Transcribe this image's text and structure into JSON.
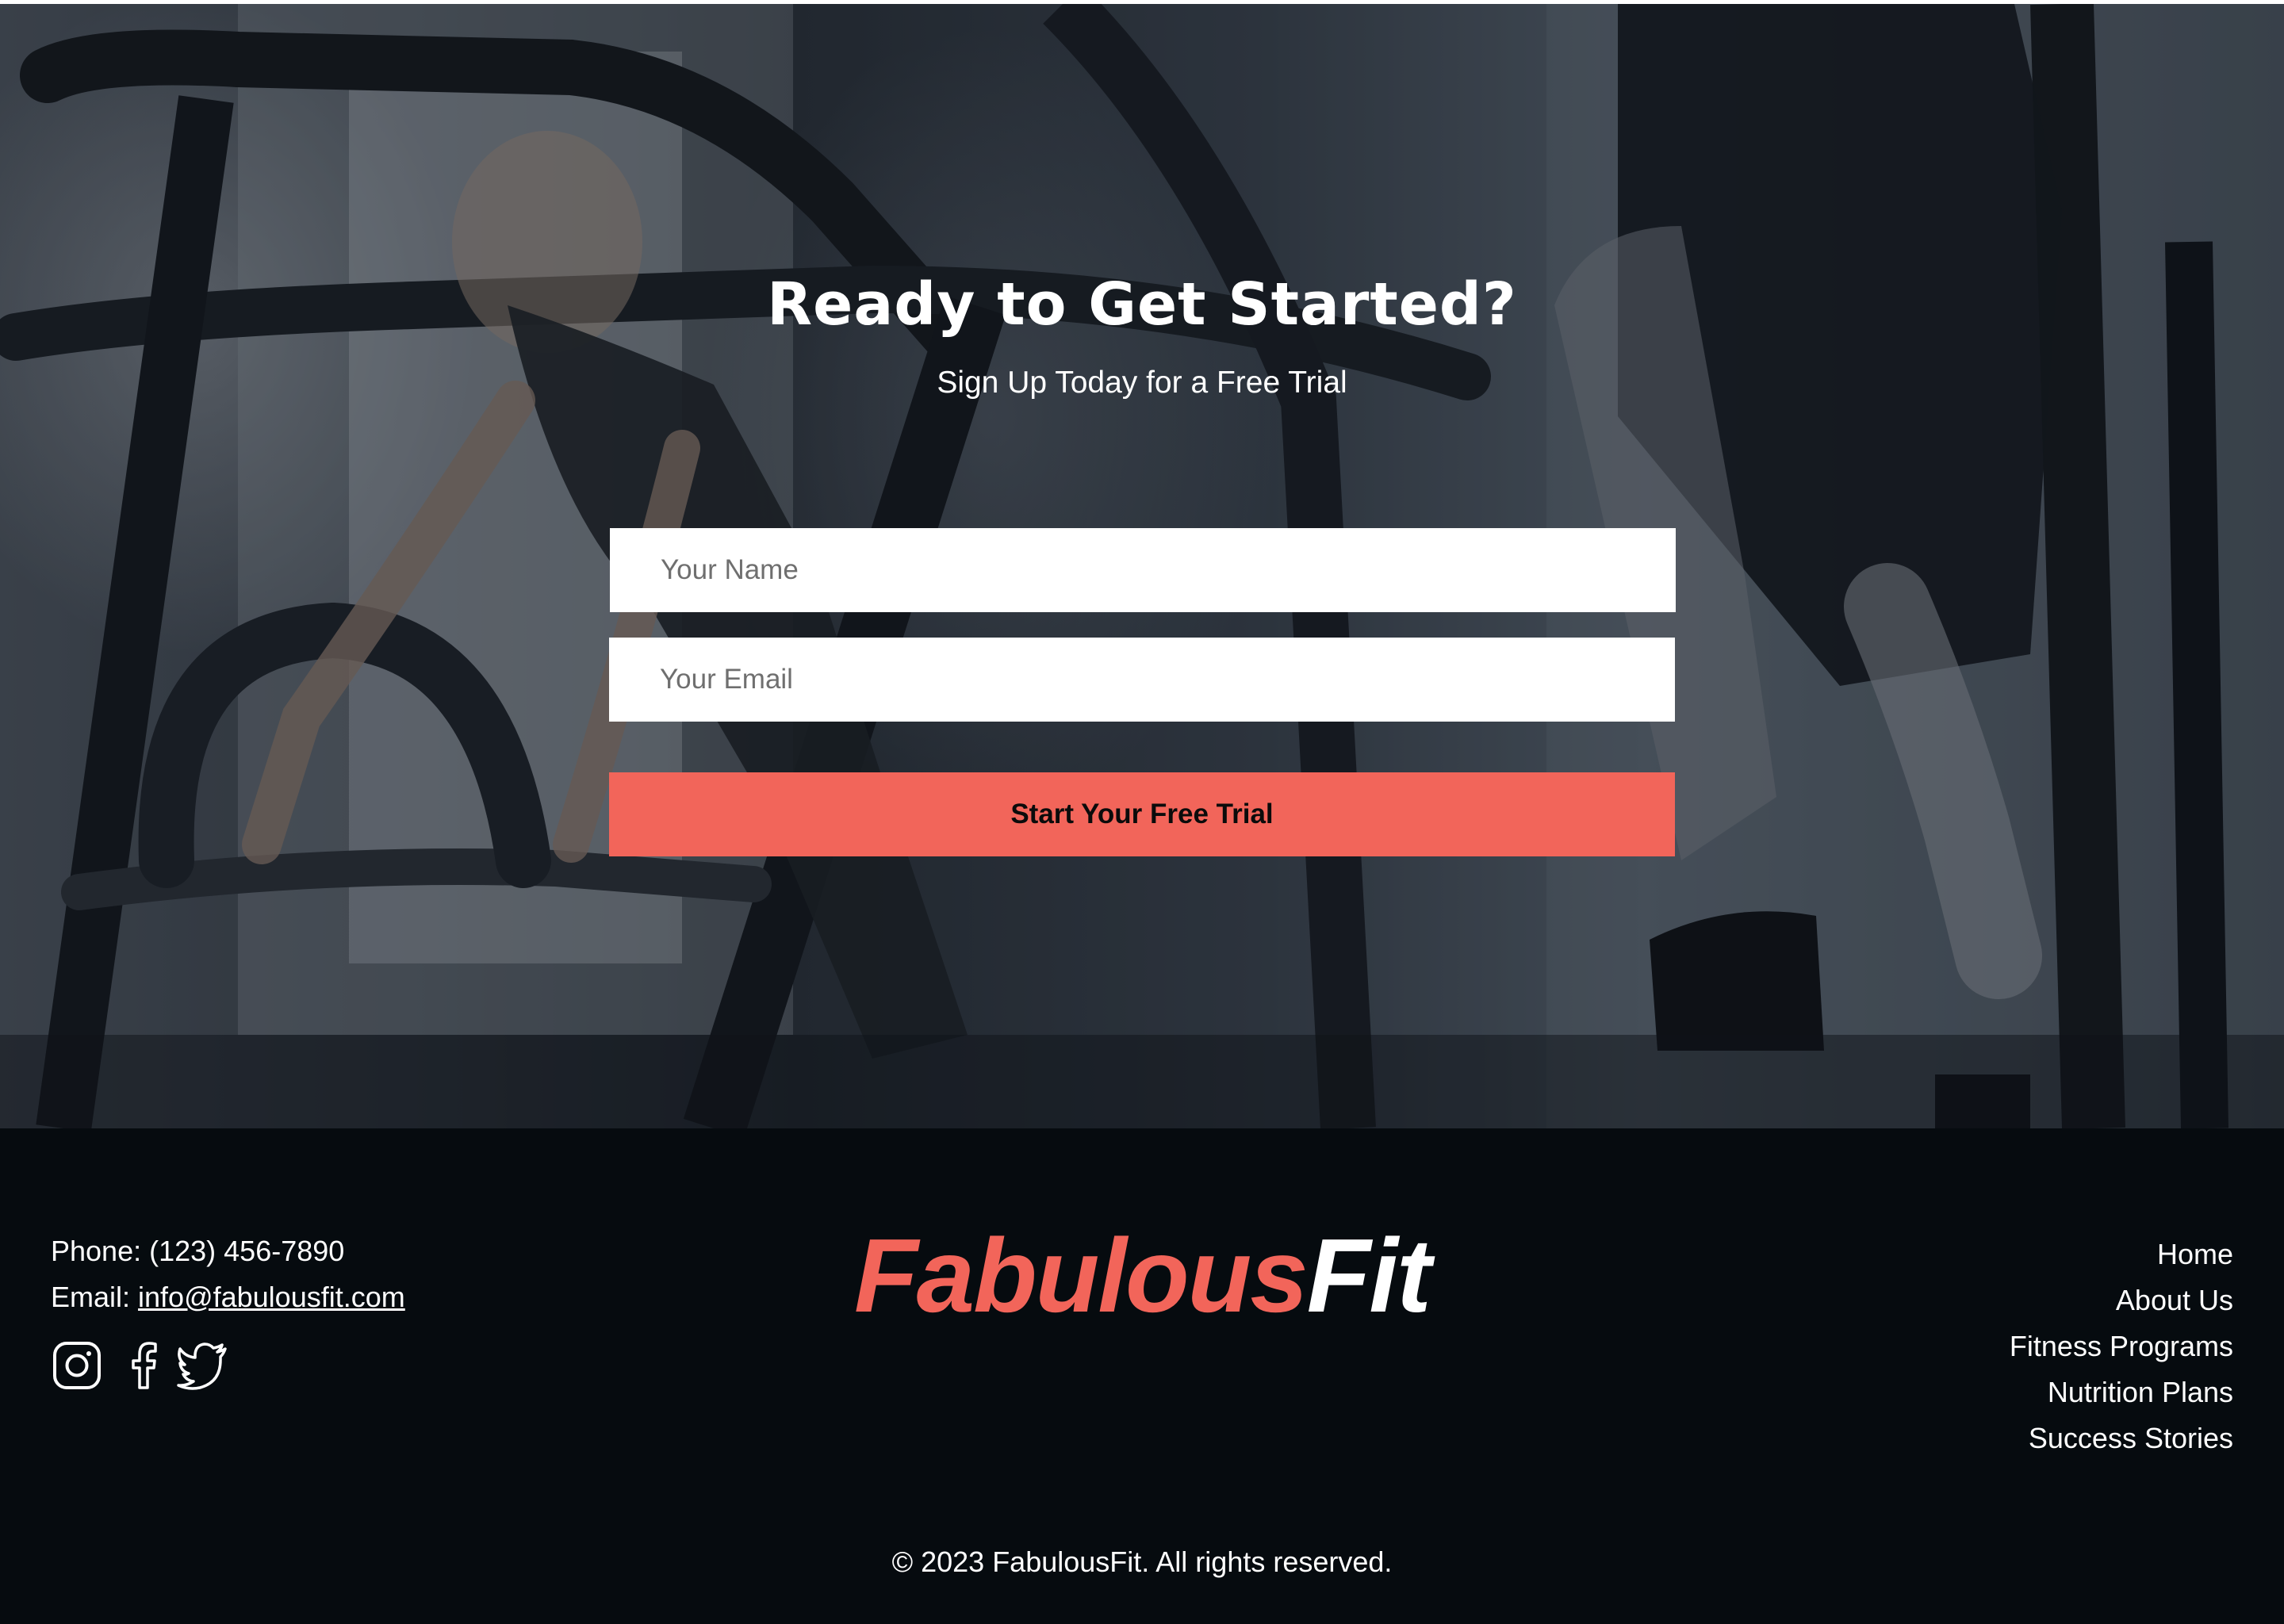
{
  "hero": {
    "title": "Ready to Get Started?",
    "subtitle": "Sign Up Today for a Free Trial",
    "background_image_label": "woman and man working out on gym machines"
  },
  "form": {
    "name_placeholder": "Your Name",
    "email_placeholder": "Your Email",
    "name_value": "",
    "email_value": "",
    "submit_label": "Start Your Free Trial"
  },
  "footer": {
    "contact": {
      "phone_label": "Phone: (123) 456-7890",
      "email_prefix": "Email: ",
      "email": "info@fabulousfit.com"
    },
    "social_icons": [
      "instagram-icon",
      "facebook-icon",
      "twitter-icon"
    ],
    "logo": {
      "part1": "Fabulous",
      "part2": "Fit"
    },
    "nav": [
      "Home",
      "About Us",
      "Fitness Programs",
      "Nutrition Plans",
      "Success Stories"
    ],
    "copyright": "© 2023 FabulousFit. All rights reserved."
  },
  "colors": {
    "accent": "#f2655a",
    "footer_bg": "#060b0f",
    "text": "#ffffff"
  }
}
